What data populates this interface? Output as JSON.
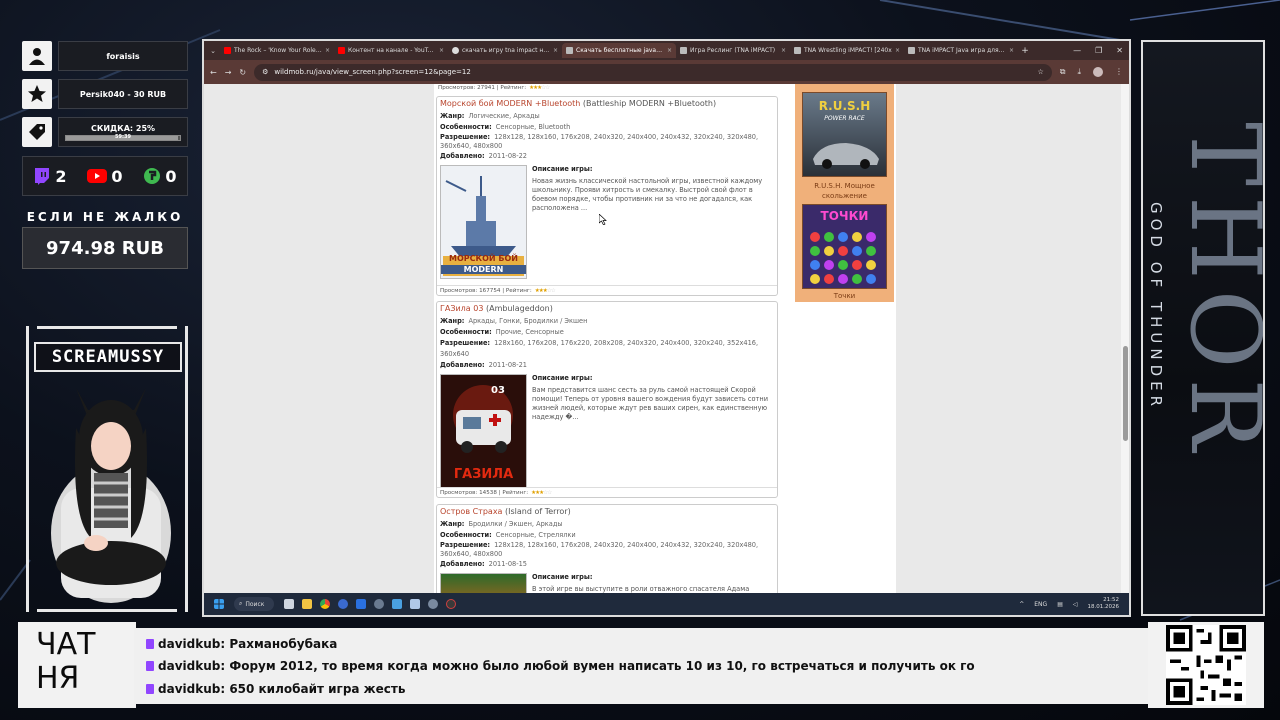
{
  "overlay": {
    "user_name": "foraisis",
    "top_donor": "Persik040 - 30 RUB",
    "discount_label": "СКИДКА: 25%",
    "discount_timer": "59:39",
    "discount_fraction": 0.99,
    "twitch_count": "2",
    "youtube_count": "0",
    "other_count": "0",
    "donate_title": "ЕСЛИ НЕ ЖАЛКО",
    "donate_amount": "974.98 RUB",
    "streamer_name": "SCREAMUSSY",
    "thor_title": "THOR",
    "thor_subtitle": "GOD OF THUNDER"
  },
  "browser": {
    "tabs": [
      {
        "label": "The Rock – 'Know Your Role' 'I'",
        "color": "#ff0000"
      },
      {
        "label": "Контент на канале - YouTube",
        "color": "#ff0000"
      },
      {
        "label": "скачать игру tna impact на ja",
        "color": "#dddddd"
      },
      {
        "label": "Скачать бесплатные java игра",
        "color": "#dddddd"
      },
      {
        "label": "Игра Реслинг (TNA iMPACT)",
        "color": "#dddddd"
      },
      {
        "label": "TNA Wrestling iMPACT! [240x",
        "color": "#dddddd"
      },
      {
        "label": "TNA iMPACT Java игра для мо",
        "color": "#dddddd"
      }
    ],
    "url": "wildmob.ru/java/view_screen.php?screen=12&page=12"
  },
  "page": {
    "top_views": "Просмотров: 27941 | Рейтинг:",
    "games": [
      {
        "title": "Морской бой MODERN +Bluetooth",
        "original": "(Battleship MODERN +Bluetooth)",
        "genre_label": "Жанр:",
        "genre": "Логические, Аркады",
        "features_label": "Особенности:",
        "features": "Сенсорные, Bluetooth",
        "res_label": "Разрешение:",
        "res": "128x128, 128x160, 176x208, 240x320, 240x400, 240x432, 320x240, 320x480, 360x640, 480x800",
        "added_label": "Добавлено:",
        "added": "2011-08-22",
        "desc_label": "Описание игры:",
        "desc": "Новая жизнь классической настольной игры, известной каждому школьнику. Прояви хитрость и смекалку. Выстрой свой флот в боевом порядке, чтобы противник ни за что не догадался, как расположена ...",
        "img_text": "МОРСКОЙ БОЙ",
        "img_sub": "MODERN",
        "footer": "Просмотров: 167754 | Рейтинг:",
        "rating": 3
      },
      {
        "title": "ГАЗила 03",
        "original": "(Ambulageddon)",
        "genre_label": "Жанр:",
        "genre": "Аркады, Гонки, Бродилки / Экшен",
        "features_label": "Особенности:",
        "features": "Прочие, Сенсорные",
        "res_label": "Разрешение:",
        "res": "128x160, 176x208, 176x220, 208x208, 240x320, 240x400, 320x240, 352x416, 360x640",
        "added_label": "Добавлено:",
        "added": "2011-08-21",
        "desc_label": "Описание игры:",
        "desc": "Вам представится шанс сесть за руль самой настоящей Скорой помощи! Теперь от уровня вашего вождения будут зависеть сотни жизней людей, которые ждут рев ваших сирен, как единственную надежду �...",
        "img_text": "ГАЗИЛА",
        "img_sub": "03",
        "footer": "Просмотров: 14538 | Рейтинг:",
        "rating": 3
      },
      {
        "title": "Остров Страха",
        "original": "(Island of Terror)",
        "genre_label": "Жанр:",
        "genre": "Бродилки / Экшен, Аркады",
        "features_label": "Особенности:",
        "features": "Сенсорные, Стрелялки",
        "res_label": "Разрешение:",
        "res": "128x128, 128x160, 176x208, 240x320, 240x400, 240x432, 320x240, 320x480, 360x640, 480x800",
        "added_label": "Добавлено:",
        "added": "2011-08-15",
        "desc_label": "Описание игры:",
        "desc": "В этой игре вы выступите в роли отважного спасателя Адама Стоуна кот..."
      }
    ],
    "sidebar": [
      {
        "caption": "R.U.S.H. Мощное скольжение",
        "img_text": "R.U.S.H",
        "img_sub": "POWER RACE"
      },
      {
        "caption": "Точки",
        "img_text": "ТОЧКИ"
      }
    ]
  },
  "taskbar": {
    "search": "Поиск",
    "lang": "ENG",
    "time": "21:52",
    "date": "18.01.2026"
  },
  "chat": {
    "label": "ЧАТ НЯ",
    "messages": [
      {
        "user": "davidkub:",
        "text": "Рахманобубака"
      },
      {
        "user": "davidkub:",
        "text": "Форум 2012, то время когда можно было любой вумен написать 10 из 10, го встречаться и получить ок го"
      },
      {
        "user": "davidkub:",
        "text": "650 килобайт игра жесть"
      }
    ]
  }
}
